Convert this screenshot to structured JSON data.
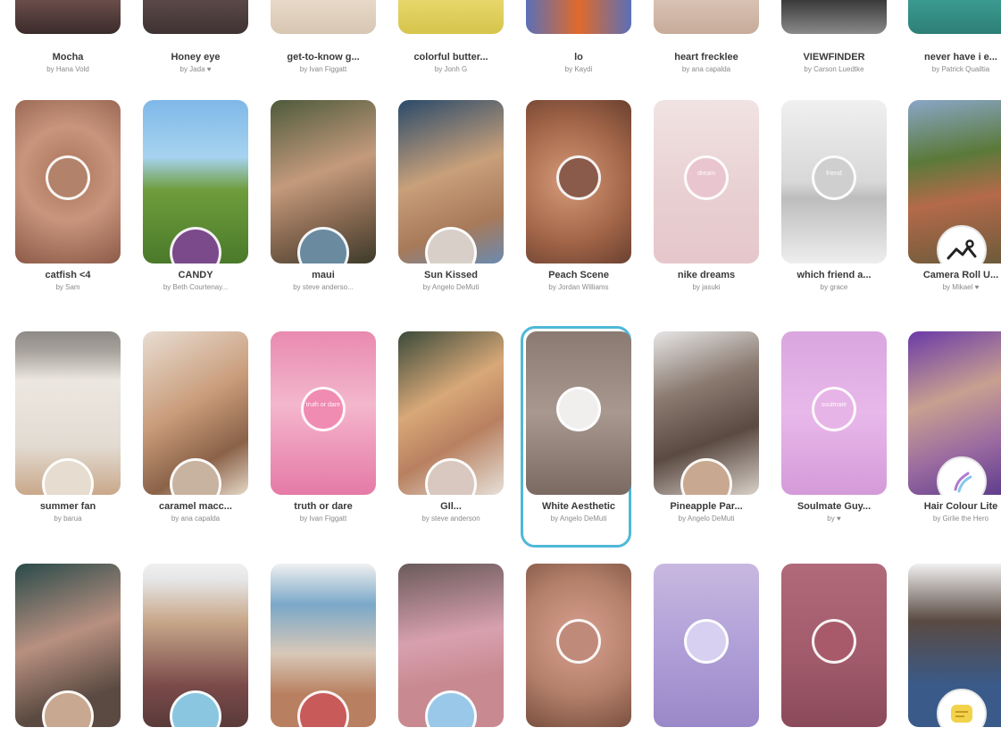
{
  "colors": {
    "selection": "#4fb8d8",
    "title": "#3a3a3a",
    "author": "#8a8a8a"
  },
  "top_row": [
    {
      "title": "Mocha",
      "author": "by Hana Vold",
      "bg": "linear-gradient(180deg,#6b4d4a,#3a2b2a)"
    },
    {
      "title": "Honey eye",
      "author": "by Jada ♥",
      "bg": "linear-gradient(180deg,#5a4848,#3f3232)"
    },
    {
      "title": "get-to-know g...",
      "author": "by Ivan Figgatt",
      "bg": "linear-gradient(180deg,#e8d9c8,#d6c6b2)"
    },
    {
      "title": "colorful butter...",
      "author": "by Jonh G",
      "bg": "linear-gradient(180deg,#e6d76a,#d5c54c)"
    },
    {
      "title": "lo",
      "author": "by Kaydi",
      "bg": "linear-gradient(90deg,#5b6fb8,#e06a2a,#5b6fb8)"
    },
    {
      "title": "heart frecklee",
      "author": "by ana capalda",
      "bg": "linear-gradient(180deg,#d9c2b3,#c7ab9a)"
    },
    {
      "title": "VIEWFINDER",
      "author": "by Carson Luedtke",
      "bg": "linear-gradient(180deg,#3a3a3a,#8a8a8a)"
    },
    {
      "title": "never have i e...",
      "author": "by Patrick Quailtia",
      "bg": "linear-gradient(180deg,#3b9a90,#2d7f76)"
    }
  ],
  "rows": [
    [
      {
        "title": "catfish <4",
        "author": "by Sam",
        "bg": "radial-gradient(circle at 50% 45%,#a9735a,#c9957d 45%,#8c5a48)",
        "circle": "center",
        "circle_bg": "#b3826a"
      },
      {
        "title": "CANDY",
        "author": "by Beth Courtenay...",
        "bg": "linear-gradient(180deg,#7fb8e8 0%,#a6d3f0 35%,#6f9d3c 55%,#4a7a2a 100%)",
        "circle": "bottom",
        "circle_bg": "#7a4a8a"
      },
      {
        "title": "maui",
        "author": "by steve anderso...",
        "bg": "linear-gradient(160deg,#4e5a3c,#c49a7c 45%,#8a6a52 70%,#3d3a2a)",
        "circle": "bottom",
        "circle_bg": "#6a8aa0"
      },
      {
        "title": "Sun Kissed",
        "author": "by Angelo DeMuti",
        "bg": "linear-gradient(160deg,#2a4a6a,#c8a07a 45%,#a87a5a 75%,#6a8ab0)",
        "circle": "bottom",
        "circle_bg": "#d8d0c8"
      },
      {
        "title": "Peach Scene",
        "author": "by Jordan Williams",
        "bg": "radial-gradient(circle at 40% 50%,#d49a78,#a6684a 55%,#6a4030)",
        "circle": "center",
        "circle_bg": "#8a5a4a"
      },
      {
        "title": "nike dreams",
        "author": "by jasuki",
        "bg": "linear-gradient(180deg,#f1e3e3,#e8cfd1 60%,#e6c7cb)",
        "circle": "center",
        "circle_bg": "#e9c6cf",
        "circle_text": "dream"
      },
      {
        "title": "which friend a...",
        "author": "by grace",
        "bg": "linear-gradient(180deg,#f0f0f0,#d8d8d8 50%,#bdbdbd 60%,#eeeeee)",
        "circle": "center",
        "circle_bg": "#cfcfcf",
        "circle_text": "friend"
      },
      {
        "title": "Camera Roll U...",
        "author": "by Mikael ♥",
        "bg": "linear-gradient(170deg,#8aa6c8,#5a7a3a 35%,#b46a4a 60%,#6a5a3a)",
        "badge": "landscape-icon"
      }
    ],
    [
      {
        "title": "summer fan",
        "author": "by barua",
        "bg": "linear-gradient(180deg,#8e8a86 0%,#a8a29c 12%,#ece7e0 30%,#e2dbd2 70%,#c9a88a 100%)",
        "circle": "bottom",
        "circle_bg": "#e6dccf"
      },
      {
        "title": "caramel macc...",
        "author": "by ana capalda",
        "bg": "linear-gradient(150deg,#e8ddd2,#c99c7a 45%,#8a6248 75%,#e6d8c8)",
        "circle": "bottom",
        "circle_bg": "#c8b3a0"
      },
      {
        "title": "truth or dare",
        "author": "by Ivan Figgatt",
        "bg": "linear-gradient(180deg,#e98ab0,#f3b7cc 45%,#ef9fbe 65%,#e57aa6)",
        "circle": "center",
        "circle_bg": "#f08bb2",
        "circle_text": "truth or dare"
      },
      {
        "title": "GIl...",
        "author": "by steve anderson",
        "bg": "linear-gradient(150deg,#3a4a3a,#d8a878 40%,#b88060 65%,#e6e0d8)",
        "circle": "bottom",
        "circle_bg": "#d8c8c0"
      },
      {
        "title": "White Aesthetic",
        "author": "by Angelo DeMuti",
        "bg": "linear-gradient(180deg,#8a7a72,#a89890 50%,#7a6a62)",
        "circle": "center",
        "circle_bg": "#f1efee",
        "selected": true
      },
      {
        "title": "Pineapple Par...",
        "author": "by Angelo DeMuti",
        "bg": "linear-gradient(160deg,#e6e6e6,#8a7a70 35%,#5a4a42 65%,#d8d0c8)",
        "circle": "bottom",
        "circle_bg": "#c8a890"
      },
      {
        "title": "Soulmate Guy...",
        "author": "by ♥",
        "bg": "linear-gradient(180deg,#d9a6df,#e8b8ea 50%,#d49ad9)",
        "circle": "center",
        "circle_bg": "#e7b4e7",
        "circle_text": "soulmate"
      },
      {
        "title": "Hair Colour Lite",
        "author": "by Girlie the Hero",
        "bg": "linear-gradient(160deg,#6a3aa8,#c8a090 40%,#9a6aa0 70%,#5a3a8a)",
        "badge": "hair-brush-icon"
      }
    ],
    [
      {
        "title": "",
        "author": "",
        "bg": "linear-gradient(160deg,#2a4a4a,#b89080 45%,#5a4a42 80%)",
        "circle": "bottom",
        "circle_bg": "#c8a890"
      },
      {
        "title": "",
        "author": "",
        "bg": "linear-gradient(180deg,#f0f0f0 0%,#e6e6e6 10%,#c8a88a 35%,#7a4a4a 75%,#5a3a3a)",
        "circle": "bottom",
        "circle_bg": "#8ac6e0"
      },
      {
        "title": "",
        "author": "",
        "bg": "linear-gradient(180deg,#f0f0f0,#7aa8c8 25%,#d8c8b8 55%,#b88060 80%)",
        "circle": "bottom",
        "circle_bg": "#c85a5a"
      },
      {
        "title": "",
        "author": "",
        "bg": "linear-gradient(170deg,#6a5a5a,#d8a0b0 45%,#c88a90 70%)",
        "circle": "bottom",
        "circle_bg": "#9ac8e8"
      },
      {
        "title": "",
        "author": "",
        "bg": "radial-gradient(circle at 50% 45%,#d8a090,#b4806a 55%,#7a5040)",
        "circle": "center",
        "circle_bg": "#c08a7a"
      },
      {
        "title": "",
        "author": "",
        "bg": "linear-gradient(180deg,#c8b8e0,#b0a0d8 50%,#9a88c8)",
        "circle": "center",
        "circle_bg": "#d8d0f0"
      },
      {
        "title": "",
        "author": "",
        "bg": "linear-gradient(180deg,#b06a7a,#a05a6a 60%,#8a4a5a)",
        "circle": "center",
        "circle_bg": "#a85a6a"
      },
      {
        "title": "",
        "author": "",
        "bg": "linear-gradient(180deg,#f0f0f0,#5a4a42 35%,#3a5a8a 75%)",
        "badge": "yellow-sticker-icon"
      }
    ]
  ]
}
